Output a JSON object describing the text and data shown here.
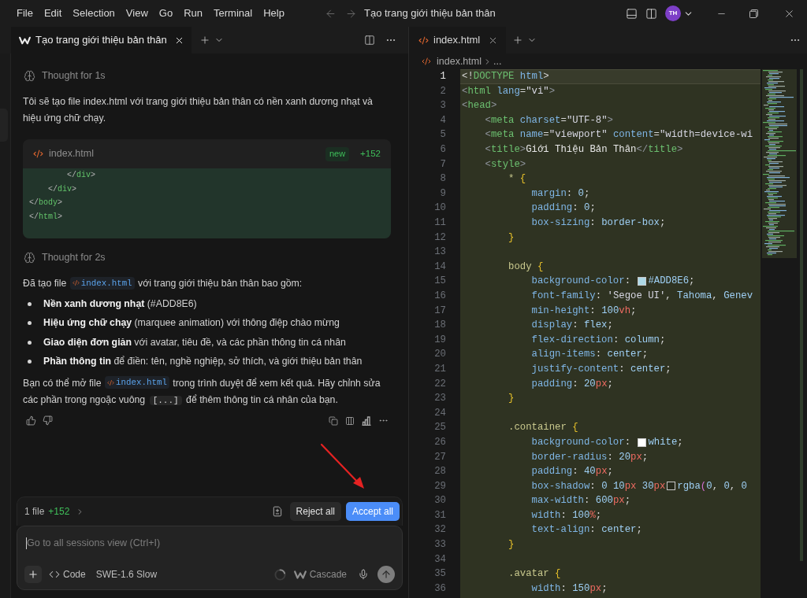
{
  "menu": [
    "File",
    "Edit",
    "Selection",
    "View",
    "Go",
    "Run",
    "Terminal",
    "Help"
  ],
  "title_bar": {
    "title": "Tạo trang giới thiệu bản thân",
    "avatar": "TH"
  },
  "chat_panel": {
    "tab": {
      "title": "Tạo trang giới thiệu bản thân",
      "selected": true
    },
    "messages": [
      {
        "kind": "thought",
        "text": "Thought for 1s"
      },
      {
        "kind": "paragraph",
        "segments": [
          {
            "kind": "text",
            "text": "Tôi sẽ tạo file index.html với trang giới thiệu bản thân có nền xanh dương nhạt và hiệu ứng chữ chạy."
          }
        ]
      },
      {
        "kind": "file_card",
        "file": "index.html",
        "badge": "new",
        "added": "+152",
        "lines": [
          {
            "tokens": [
              {
                "kind": "punct",
                "text": "        </"
              },
              {
                "kind": "tag",
                "text": "div"
              },
              {
                "kind": "punct",
                "text": ">"
              }
            ]
          },
          {
            "tokens": [
              {
                "kind": "punct",
                "text": "    </"
              },
              {
                "kind": "tag",
                "text": "div"
              },
              {
                "kind": "punct",
                "text": ">"
              }
            ]
          },
          {
            "tokens": [
              {
                "kind": "punct",
                "text": "</"
              },
              {
                "kind": "tag",
                "text": "body"
              },
              {
                "kind": "punct",
                "text": ">"
              }
            ]
          },
          {
            "tokens": [
              {
                "kind": "punct",
                "text": "</"
              },
              {
                "kind": "tag",
                "text": "html"
              },
              {
                "kind": "punct",
                "text": ">"
              }
            ]
          }
        ]
      },
      {
        "kind": "thought",
        "text": "Thought for 2s"
      },
      {
        "kind": "paragraph",
        "segments": [
          {
            "kind": "text",
            "text": "Đã tạo file "
          },
          {
            "kind": "file",
            "text": "index.html"
          },
          {
            "kind": "text",
            "text": " với trang giới thiệu bản thân bao gồm:"
          }
        ]
      },
      {
        "kind": "bullets",
        "items": [
          "**Nền xanh dương nhạt** (#ADD8E6)",
          "**Hiệu ứng chữ chạy** (marquee animation) với thông điệp chào mừng",
          "**Giao diện đơn giản** với avatar, tiêu đề, và các phần thông tin cá nhân",
          "**Phần thông tin** để điền: tên, nghề nghiệp, sở thích, và giới thiệu bản thân"
        ]
      },
      {
        "kind": "paragraph",
        "segments": [
          {
            "kind": "text",
            "text": "Bạn có thể mở file "
          },
          {
            "kind": "file",
            "text": "index.html"
          },
          {
            "kind": "text",
            "text": " trong trình duyệt để xem kết quả. Hãy chỉnh sửa các phần trong ngoặc vuông "
          },
          {
            "kind": "code",
            "text": "[...]"
          },
          {
            "kind": "text",
            "text": " để thêm thông tin cá nhân của bạn."
          }
        ]
      }
    ],
    "changes": {
      "summary": "1 file",
      "added": "+152",
      "buttons": [
        {
          "label": "Reject all",
          "kind": "secondary"
        },
        {
          "label": "Accept all",
          "kind": "primary"
        }
      ]
    },
    "composer": {
      "placeholder": "Go to all sessions view (Ctrl+I)",
      "mode": "Code",
      "model": "SWE-1.6 Slow",
      "agent": "Cascade"
    }
  },
  "editor": {
    "tab": {
      "title": "index.html",
      "selected": true
    },
    "breadcrumb": [
      "index.html",
      "..."
    ],
    "lines": [
      {
        "number": "1",
        "active": true,
        "tokens": [
          {
            "kind": "plain",
            "text": "<!"
          },
          {
            "kind": "tag",
            "text": "DOCTYPE"
          },
          {
            "kind": "attr",
            "text": " html"
          },
          {
            "kind": "plain",
            "text": ">"
          }
        ]
      },
      {
        "number": "2",
        "active": false,
        "tokens": [
          {
            "kind": "punct",
            "text": "<"
          },
          {
            "kind": "tag",
            "text": "html"
          },
          {
            "kind": "attr",
            "text": " lang"
          },
          {
            "kind": "plain",
            "text": "="
          },
          {
            "kind": "string",
            "text": "\"vi\""
          },
          {
            "kind": "punct",
            "text": ">"
          }
        ]
      },
      {
        "number": "3",
        "active": false,
        "tokens": [
          {
            "kind": "punct",
            "text": "<"
          },
          {
            "kind": "tag",
            "text": "head"
          },
          {
            "kind": "punct",
            "text": ">"
          }
        ]
      },
      {
        "number": "4",
        "active": false,
        "tokens": [
          {
            "kind": "punct",
            "text": "    <"
          },
          {
            "kind": "tag",
            "text": "meta"
          },
          {
            "kind": "attr",
            "text": " charset"
          },
          {
            "kind": "plain",
            "text": "="
          },
          {
            "kind": "string",
            "text": "\"UTF-8\""
          },
          {
            "kind": "punct",
            "text": ">"
          }
        ]
      },
      {
        "number": "5",
        "active": false,
        "tokens": [
          {
            "kind": "punct",
            "text": "    <"
          },
          {
            "kind": "tag",
            "text": "meta"
          },
          {
            "kind": "attr",
            "text": " name"
          },
          {
            "kind": "plain",
            "text": "="
          },
          {
            "kind": "string",
            "text": "\"viewport\""
          },
          {
            "kind": "attr",
            "text": " content"
          },
          {
            "kind": "plain",
            "text": "="
          },
          {
            "kind": "string",
            "text": "\"width=device-wi"
          }
        ]
      },
      {
        "number": "6",
        "active": false,
        "tokens": [
          {
            "kind": "punct",
            "text": "    <"
          },
          {
            "kind": "tag",
            "text": "title"
          },
          {
            "kind": "punct",
            "text": ">"
          },
          {
            "kind": "text",
            "text": "Giới Thiệu Bản Thân"
          },
          {
            "kind": "punct",
            "text": "</"
          },
          {
            "kind": "tag",
            "text": "title"
          },
          {
            "kind": "punct",
            "text": ">"
          }
        ]
      },
      {
        "number": "7",
        "active": false,
        "tokens": [
          {
            "kind": "punct",
            "text": "    <"
          },
          {
            "kind": "tag",
            "text": "style"
          },
          {
            "kind": "punct",
            "text": ">"
          }
        ]
      },
      {
        "number": "8",
        "active": false,
        "tokens": [
          {
            "kind": "selector",
            "text": "        *"
          },
          {
            "kind": "brace",
            "text": " {"
          }
        ]
      },
      {
        "number": "9",
        "active": false,
        "tokens": [
          {
            "kind": "prop",
            "text": "            margin"
          },
          {
            "kind": "plain",
            "text": ": "
          },
          {
            "kind": "value",
            "text": "0"
          },
          {
            "kind": "plain",
            "text": ";"
          }
        ]
      },
      {
        "number": "10",
        "active": false,
        "tokens": [
          {
            "kind": "prop",
            "text": "            padding"
          },
          {
            "kind": "plain",
            "text": ": "
          },
          {
            "kind": "value",
            "text": "0"
          },
          {
            "kind": "plain",
            "text": ";"
          }
        ]
      },
      {
        "number": "11",
        "active": false,
        "tokens": [
          {
            "kind": "prop",
            "text": "            box-sizing"
          },
          {
            "kind": "plain",
            "text": ": "
          },
          {
            "kind": "value",
            "text": "border-box"
          },
          {
            "kind": "plain",
            "text": ";"
          }
        ]
      },
      {
        "number": "12",
        "active": false,
        "tokens": [
          {
            "kind": "brace",
            "text": "        }"
          }
        ]
      },
      {
        "number": "13",
        "active": false
      },
      {
        "number": "14",
        "active": false,
        "tokens": [
          {
            "kind": "selector",
            "text": "        body"
          },
          {
            "kind": "brace",
            "text": " {"
          }
        ]
      },
      {
        "number": "15",
        "active": false,
        "tokens": [
          {
            "kind": "prop",
            "text": "            background-color"
          },
          {
            "kind": "plain",
            "text": ": "
          },
          {
            "kind": "swatch",
            "color": "#add8e6"
          },
          {
            "kind": "value",
            "text": "#ADD8E6"
          },
          {
            "kind": "plain",
            "text": ";"
          }
        ]
      },
      {
        "number": "16",
        "active": false,
        "tokens": [
          {
            "kind": "prop",
            "text": "            font-family"
          },
          {
            "kind": "plain",
            "text": ": "
          },
          {
            "kind": "string",
            "text": "'Segoe UI'"
          },
          {
            "kind": "plain",
            "text": ", "
          },
          {
            "kind": "value",
            "text": "Tahoma"
          },
          {
            "kind": "plain",
            "text": ", "
          },
          {
            "kind": "value",
            "text": "Genev"
          }
        ]
      },
      {
        "number": "17",
        "active": false,
        "tokens": [
          {
            "kind": "prop",
            "text": "            min-height"
          },
          {
            "kind": "plain",
            "text": ": "
          },
          {
            "kind": "value",
            "text": "100"
          },
          {
            "kind": "unit",
            "text": "vh"
          },
          {
            "kind": "plain",
            "text": ";"
          }
        ]
      },
      {
        "number": "18",
        "active": false,
        "tokens": [
          {
            "kind": "prop",
            "text": "            display"
          },
          {
            "kind": "plain",
            "text": ": "
          },
          {
            "kind": "value",
            "text": "flex"
          },
          {
            "kind": "plain",
            "text": ";"
          }
        ]
      },
      {
        "number": "19",
        "active": false,
        "tokens": [
          {
            "kind": "prop",
            "text": "            flex-direction"
          },
          {
            "kind": "plain",
            "text": ": "
          },
          {
            "kind": "value",
            "text": "column"
          },
          {
            "kind": "plain",
            "text": ";"
          }
        ]
      },
      {
        "number": "20",
        "active": false,
        "tokens": [
          {
            "kind": "prop",
            "text": "            align-items"
          },
          {
            "kind": "plain",
            "text": ": "
          },
          {
            "kind": "value",
            "text": "center"
          },
          {
            "kind": "plain",
            "text": ";"
          }
        ]
      },
      {
        "number": "21",
        "active": false,
        "tokens": [
          {
            "kind": "prop",
            "text": "            justify-content"
          },
          {
            "kind": "plain",
            "text": ": "
          },
          {
            "kind": "value",
            "text": "center"
          },
          {
            "kind": "plain",
            "text": ";"
          }
        ]
      },
      {
        "number": "22",
        "active": false,
        "tokens": [
          {
            "kind": "prop",
            "text": "            padding"
          },
          {
            "kind": "plain",
            "text": ": "
          },
          {
            "kind": "value",
            "text": "20"
          },
          {
            "kind": "unit",
            "text": "px"
          },
          {
            "kind": "plain",
            "text": ";"
          }
        ]
      },
      {
        "number": "23",
        "active": false,
        "tokens": [
          {
            "kind": "brace",
            "text": "        }"
          }
        ]
      },
      {
        "number": "24",
        "active": false
      },
      {
        "number": "25",
        "active": false,
        "tokens": [
          {
            "kind": "selector",
            "text": "        .container"
          },
          {
            "kind": "brace",
            "text": " {"
          }
        ]
      },
      {
        "number": "26",
        "active": false,
        "tokens": [
          {
            "kind": "prop",
            "text": "            background-color"
          },
          {
            "kind": "plain",
            "text": ": "
          },
          {
            "kind": "swatch",
            "color": "#ffffff"
          },
          {
            "kind": "value",
            "text": "white"
          },
          {
            "kind": "plain",
            "text": ";"
          }
        ]
      },
      {
        "number": "27",
        "active": false,
        "tokens": [
          {
            "kind": "prop",
            "text": "            border-radius"
          },
          {
            "kind": "plain",
            "text": ": "
          },
          {
            "kind": "value",
            "text": "20"
          },
          {
            "kind": "unit",
            "text": "px"
          },
          {
            "kind": "plain",
            "text": ";"
          }
        ]
      },
      {
        "number": "28",
        "active": false,
        "tokens": [
          {
            "kind": "prop",
            "text": "            padding"
          },
          {
            "kind": "plain",
            "text": ": "
          },
          {
            "kind": "value",
            "text": "40"
          },
          {
            "kind": "unit",
            "text": "px"
          },
          {
            "kind": "plain",
            "text": ";"
          }
        ]
      },
      {
        "number": "29",
        "active": false,
        "tokens": [
          {
            "kind": "prop",
            "text": "            box-shadow"
          },
          {
            "kind": "plain",
            "text": ": "
          },
          {
            "kind": "value",
            "text": "0 10"
          },
          {
            "kind": "unit",
            "text": "px"
          },
          {
            "kind": "value",
            "text": " 30"
          },
          {
            "kind": "unit",
            "text": "px"
          },
          {
            "kind": "swatch",
            "color": "#262a1c"
          },
          {
            "kind": "value",
            "text": "rgba"
          },
          {
            "kind": "paren",
            "text": "("
          },
          {
            "kind": "value",
            "text": "0"
          },
          {
            "kind": "plain",
            "text": ", "
          },
          {
            "kind": "value",
            "text": "0"
          },
          {
            "kind": "plain",
            "text": ", "
          },
          {
            "kind": "value",
            "text": "0"
          }
        ]
      },
      {
        "number": "30",
        "active": false,
        "tokens": [
          {
            "kind": "prop",
            "text": "            max-width"
          },
          {
            "kind": "plain",
            "text": ": "
          },
          {
            "kind": "value",
            "text": "600"
          },
          {
            "kind": "unit",
            "text": "px"
          },
          {
            "kind": "plain",
            "text": ";"
          }
        ]
      },
      {
        "number": "31",
        "active": false,
        "tokens": [
          {
            "kind": "prop",
            "text": "            width"
          },
          {
            "kind": "plain",
            "text": ": "
          },
          {
            "kind": "value",
            "text": "100"
          },
          {
            "kind": "unit",
            "text": "%"
          },
          {
            "kind": "plain",
            "text": ";"
          }
        ]
      },
      {
        "number": "32",
        "active": false,
        "tokens": [
          {
            "kind": "prop",
            "text": "            text-align"
          },
          {
            "kind": "plain",
            "text": ": "
          },
          {
            "kind": "value",
            "text": "center"
          },
          {
            "kind": "plain",
            "text": ";"
          }
        ]
      },
      {
        "number": "33",
        "active": false,
        "tokens": [
          {
            "kind": "brace",
            "text": "        }"
          }
        ]
      },
      {
        "number": "34",
        "active": false
      },
      {
        "number": "35",
        "active": false,
        "tokens": [
          {
            "kind": "selector",
            "text": "        .avatar"
          },
          {
            "kind": "brace",
            "text": " {"
          }
        ]
      },
      {
        "number": "36",
        "active": false,
        "tokens": [
          {
            "kind": "prop",
            "text": "            width"
          },
          {
            "kind": "plain",
            "text": ": "
          },
          {
            "kind": "value",
            "text": "150"
          },
          {
            "kind": "unit",
            "text": "px"
          },
          {
            "kind": "plain",
            "text": ";"
          }
        ]
      }
    ]
  }
}
